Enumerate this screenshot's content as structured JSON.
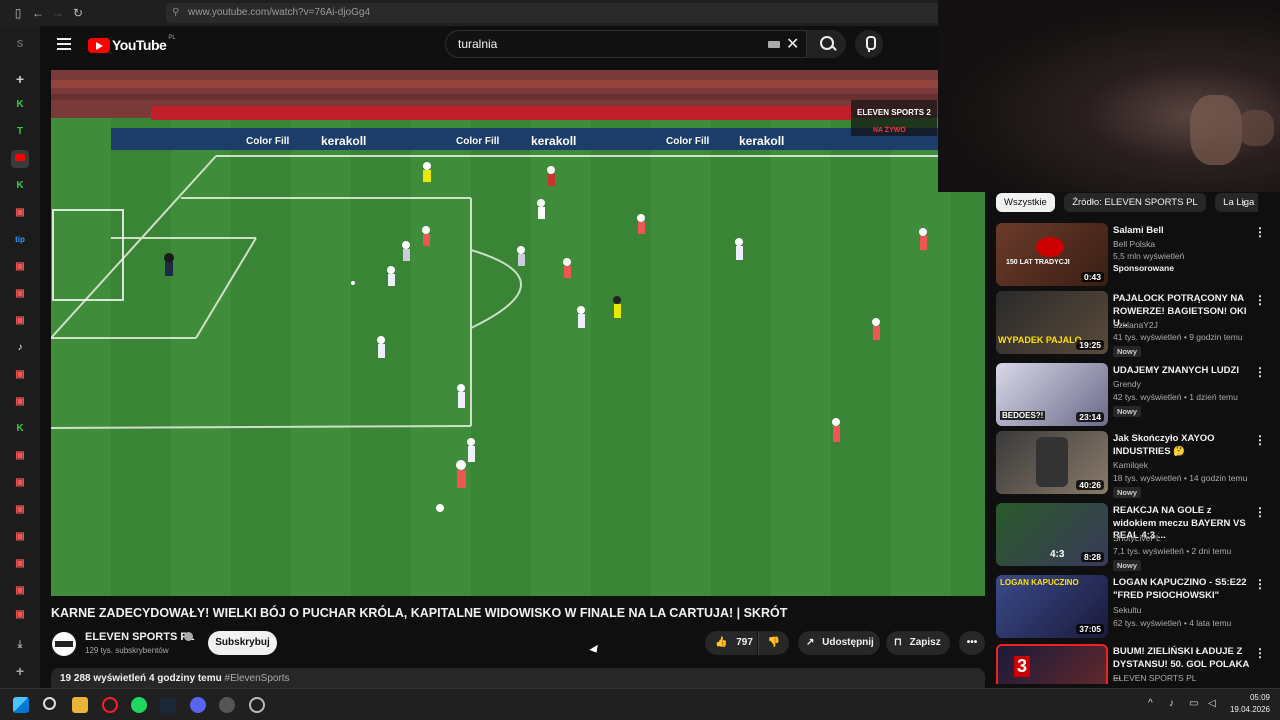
{
  "browser": {
    "url": "www.youtube.com/watch?v=76Ai-djoGg4"
  },
  "header": {
    "logo_text": "YouTube",
    "region": "PL",
    "search_value": "turalnia"
  },
  "video": {
    "title": "KARNE ZADECYDOWAŁY! WIELKI BÓJ O PUCHAR KRÓLA, KAPITALNE WIDOWISKO W FINALE NA LA CARTUJA! | SKRÓT",
    "channel": "ELEVEN SPORTS PL",
    "subscribers": "129 tys. subskrybentów",
    "subscribe_label": "Subskrybuj",
    "likes": "797",
    "share_label": "Udostępnij",
    "save_label": "Zapisz",
    "views_time": "19 288 wyświetleń  4 godziny temu",
    "hashtag": "#ElevenSports",
    "overlay_board_1": "kerakoll",
    "overlay_board_2": "Color Fill",
    "broadcaster": "ELEVEN SPORTS 2",
    "live_label": "NA ŻYWO"
  },
  "chips": [
    {
      "label": "Wszystkie"
    },
    {
      "label": "Źródło: ELEVEN SPORTS PL"
    },
    {
      "label": "La Liga"
    }
  ],
  "recommendations": [
    {
      "title": "Salami Bell",
      "channel": "Bell Polska",
      "meta": "5,5 mln wyświetleń",
      "badge": "Sponsorowane",
      "duration": "0:43",
      "thumb_text": "150 LAT TRADYCJI"
    },
    {
      "title": "PAJALOCK POTRĄCONY NA ROWERZE! BAGIETSON! OKI U...",
      "channel": "SzklanaY2J",
      "meta": "41 tys. wyświetleń • 9 godzin temu",
      "badge": "Nowy",
      "duration": "19:25",
      "thumb_text": "WYPADEK PAJALO"
    },
    {
      "title": "UDAJEMY ZNANYCH LUDZI",
      "channel": "Grendy",
      "meta": "42 tys. wyświetleń • 1 dzień temu",
      "badge": "Nowy",
      "duration": "23:14",
      "thumb_text": "BEDOES?!"
    },
    {
      "title": "Jak Skończyło XAYOO INDUSTRIES 🤔",
      "channel": "Kamilqek",
      "meta": "18 tys. wyświetleń • 14 godzin temu",
      "badge": "Nowy",
      "duration": "40:26",
      "thumb_text": ""
    },
    {
      "title": "REAKCJA NA GOLE z widokiem meczu BAYERN VS REAL 4:3 ...",
      "channel": "ShotyLivePL",
      "meta": "7,1 tys. wyświetleń • 2 dni temu",
      "badge": "Nowy",
      "duration": "8:28",
      "thumb_text": "4:3"
    },
    {
      "title": "LOGAN KAPUCZINO - S5:E22 \"FRED PSIOCHOWSKI\"",
      "channel": "Sekultu",
      "meta": "62 tys. wyświetleń • 4 lata temu",
      "badge": "",
      "duration": "37:05",
      "thumb_text": "LOGAN KAPUCZINO"
    },
    {
      "title": "BUUM! ZIELIŃSKI ŁADUJE Z DYSTANSU! 50. GOL POLAKA ...",
      "channel": "ELEVEN SPORTS PL",
      "meta": "",
      "badge": "",
      "duration": "",
      "thumb_text": "3"
    }
  ],
  "taskbar": {
    "time": "05:09",
    "date": "19.04.2026"
  },
  "colors": {
    "background": "#0f0f0f",
    "youtube_red": "#ff0000",
    "pitch_green": "#3e8a3a"
  }
}
